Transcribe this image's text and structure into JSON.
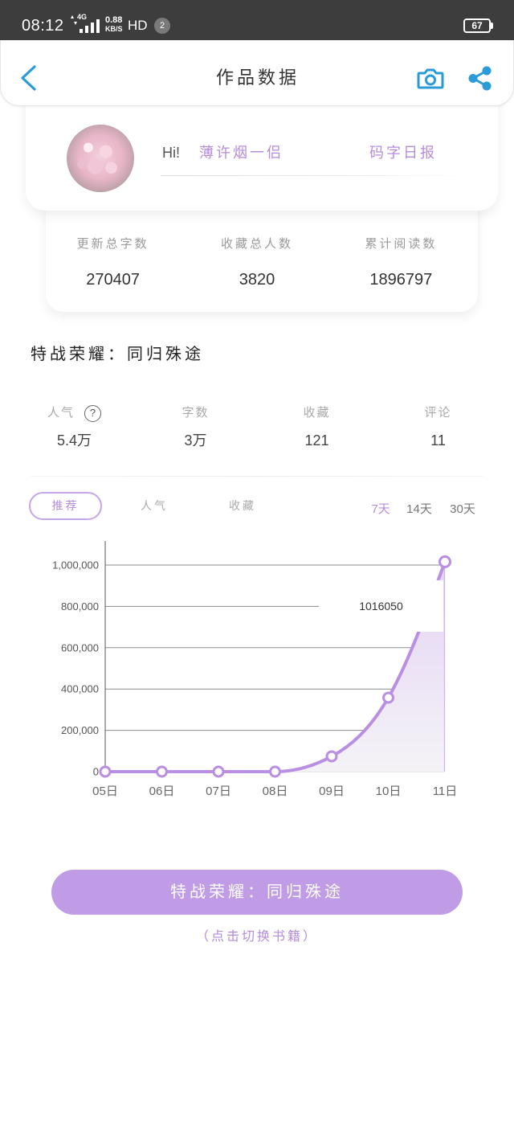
{
  "status_bar": {
    "time": "08:12",
    "network": "4G",
    "speed_value": "0.88",
    "speed_unit": "KB/S",
    "hd": "HD",
    "notification_count": "2",
    "battery": "67",
    "icons": [
      "data-activity-icon",
      "signal-icon",
      "battery-icon"
    ]
  },
  "header": {
    "title": "作品数据",
    "icons": {
      "back": "chevron-left-icon",
      "camera": "camera-icon",
      "share": "share-icon"
    }
  },
  "profile": {
    "greeting": "Hi!",
    "username": "薄许烟一侣",
    "daily_report": "码字日报"
  },
  "summary": [
    {
      "label": "更新总字数",
      "value": "270407"
    },
    {
      "label": "收藏总人数",
      "value": "3820"
    },
    {
      "label": "累计阅读数",
      "value": "1896797"
    }
  ],
  "book": {
    "title": "特战荣耀：同归殊途"
  },
  "metrics": [
    {
      "label": "人气",
      "value": "5.4万",
      "help": "?"
    },
    {
      "label": "字数",
      "value": "3万"
    },
    {
      "label": "收藏",
      "value": "121"
    },
    {
      "label": "评论",
      "value": "11"
    }
  ],
  "chart_tabs": {
    "types": [
      "推荐",
      "人气",
      "收藏"
    ],
    "selected_type_index": 0,
    "ranges": [
      "7天",
      "14天",
      "30天"
    ],
    "selected_range_index": 0
  },
  "chart_data": {
    "type": "line",
    "smooth": true,
    "area_fill": true,
    "x": [
      "05日",
      "06日",
      "07日",
      "08日",
      "09日",
      "10日",
      "11日"
    ],
    "values": [
      0,
      0,
      0,
      0,
      74000,
      358000,
      1016050
    ],
    "ylim": [
      0,
      1000000
    ],
    "y_ticks": [
      0,
      200000,
      400000,
      600000,
      800000,
      1000000
    ],
    "y_tick_labels": [
      "0",
      "200,000",
      "400,000",
      "600,000",
      "800,000",
      "1,000,000"
    ],
    "grid": true,
    "tooltip": {
      "index": 6,
      "label": "1016050"
    }
  },
  "switch_book": {
    "button_label": "特战荣耀：同归殊途",
    "hint": "（点击切换书籍）"
  },
  "colors": {
    "status_bar": "#3d3d3d",
    "accent_blue": "#2a9ad9",
    "purple_text": "#b48cdc",
    "chart_line": "#b98ee3",
    "button": "#c09be6"
  }
}
